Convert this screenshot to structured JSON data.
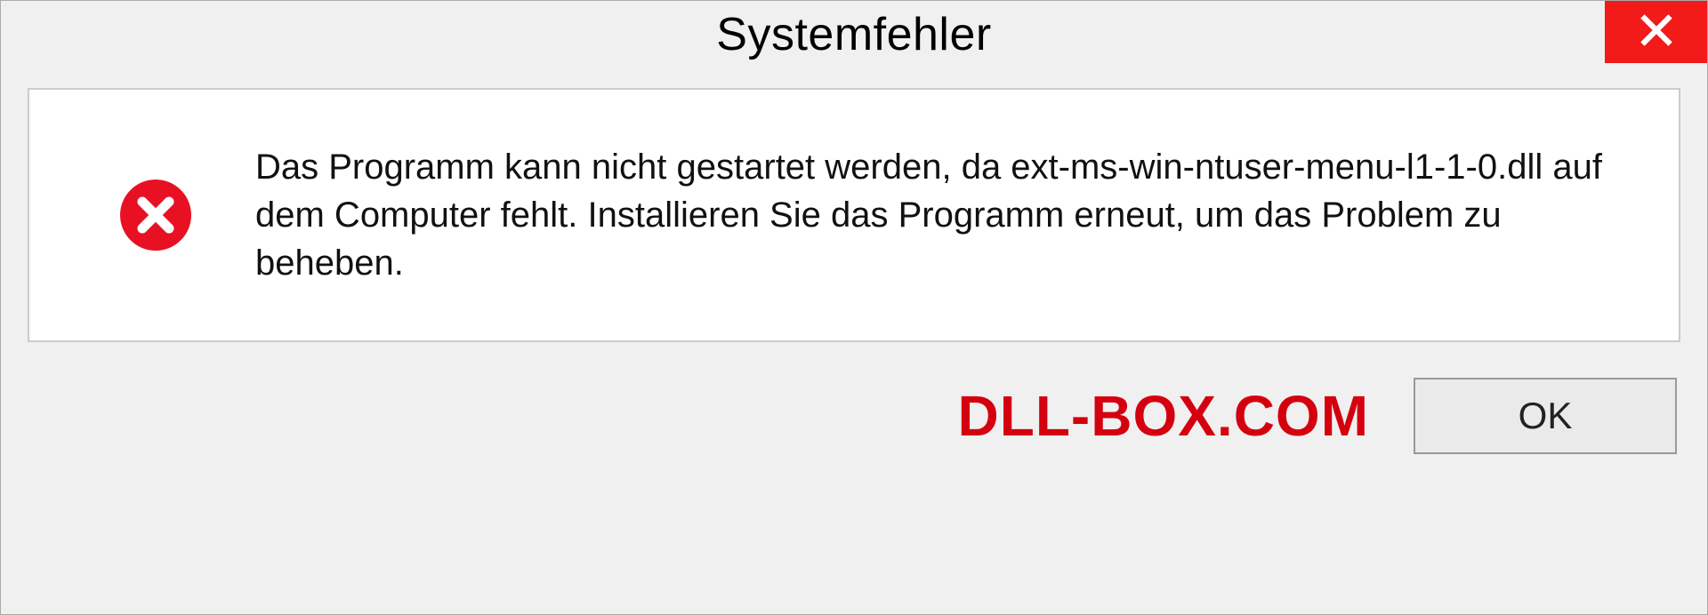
{
  "dialog": {
    "title": "Systemfehler",
    "message": "Das Programm kann nicht gestartet werden, da ext-ms-win-ntuser-menu-l1-1-0.dll auf dem Computer fehlt. Installieren Sie das Programm erneut, um das Problem zu beheben.",
    "ok_label": "OK"
  },
  "watermark": "DLL-BOX.COM",
  "colors": {
    "close_red": "#f31a1a",
    "watermark_red": "#d4000f",
    "error_icon_red": "#e81123"
  }
}
